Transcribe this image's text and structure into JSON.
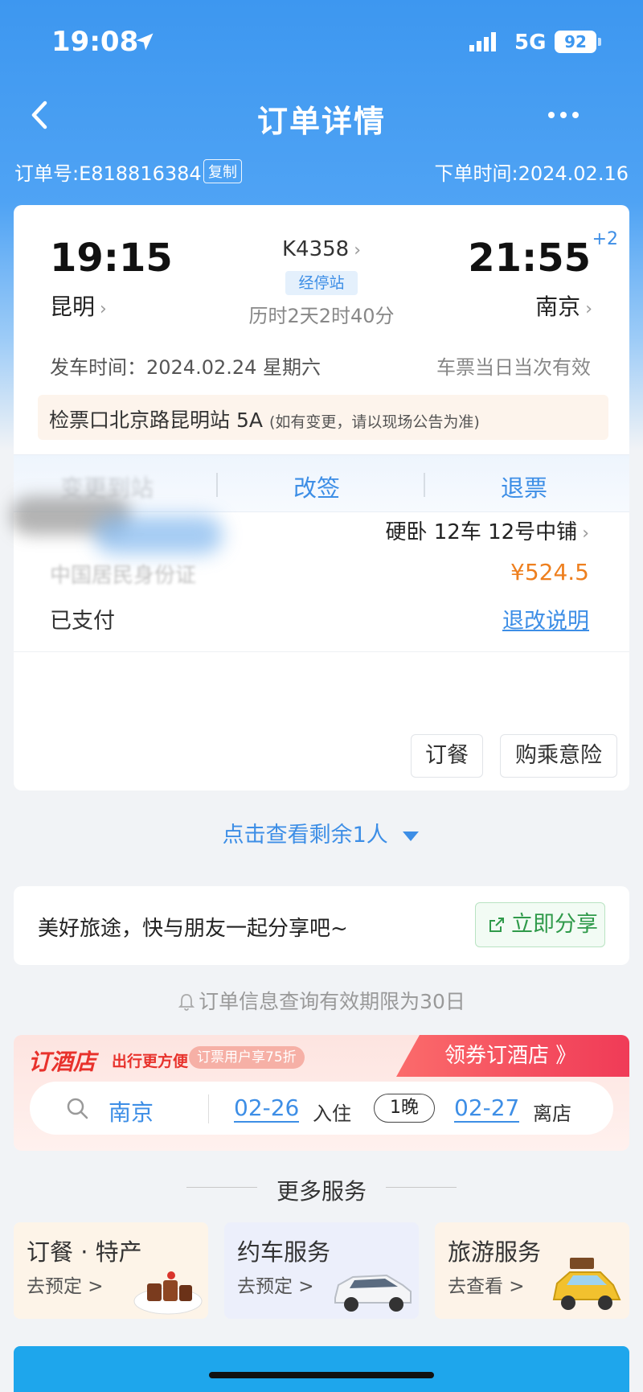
{
  "status_bar": {
    "time": "19:08",
    "network": "5G",
    "battery": "92"
  },
  "nav": {
    "title": "订单详情"
  },
  "order": {
    "number": "订单号:E818816384",
    "copy_label": "复制",
    "order_time": "下单时间:2024.02.16"
  },
  "trip": {
    "departure_time": "19:15",
    "departure_station": "昆明",
    "train_number": "K4358",
    "stops_label": "经停站",
    "duration": "历时2天2时40分",
    "arrival_time": "21:55",
    "arrival_day_offset": "+2",
    "arrival_station": "南京",
    "departure_date": "发车时间：2024.02.24 星期六",
    "validity": "车票当日当次有效",
    "gate": "检票口北京路昆明站 5A",
    "gate_note": "(如有变更，请以现场公告为准)"
  },
  "actions": {
    "change_station": "变更到站",
    "reschedule": "改签",
    "refund": "退票"
  },
  "passenger": {
    "seat": "硬卧 12车 12号中铺",
    "id_type": "中国居民身份证",
    "price": "¥524.5",
    "payment_status": "已支付",
    "rules_link": "退改说明",
    "meal_button": "订餐",
    "insurance_button": "购乘意险"
  },
  "more_passengers": "点击查看剩余1人",
  "share": {
    "text": "美好旅途，快与朋友一起分享吧~",
    "button": "立即分享"
  },
  "notice": "订单信息查询有效期限为30日",
  "hotel": {
    "logo": "订酒店",
    "subtitle": "出行更方便",
    "badge": "订票用户享75折",
    "cta": "领券订酒店 》",
    "city": "南京",
    "checkin_date": "02-26",
    "checkin_label": "入住",
    "nights": "1晚",
    "checkout_date": "02-27",
    "checkout_label": "离店"
  },
  "more_services": {
    "title": "更多服务",
    "items": [
      {
        "title": "订餐 · 特产",
        "subtitle": "去预定 >"
      },
      {
        "title": "约车服务",
        "subtitle": "去预定 >"
      },
      {
        "title": "旅游服务",
        "subtitle": "去查看 >"
      }
    ]
  },
  "colors": {
    "primary": "#3d8ee6",
    "header": "#3d97f0",
    "price": "#ee7f1e",
    "share": "#2f9a4a",
    "hotel_red": "#e8322c"
  }
}
